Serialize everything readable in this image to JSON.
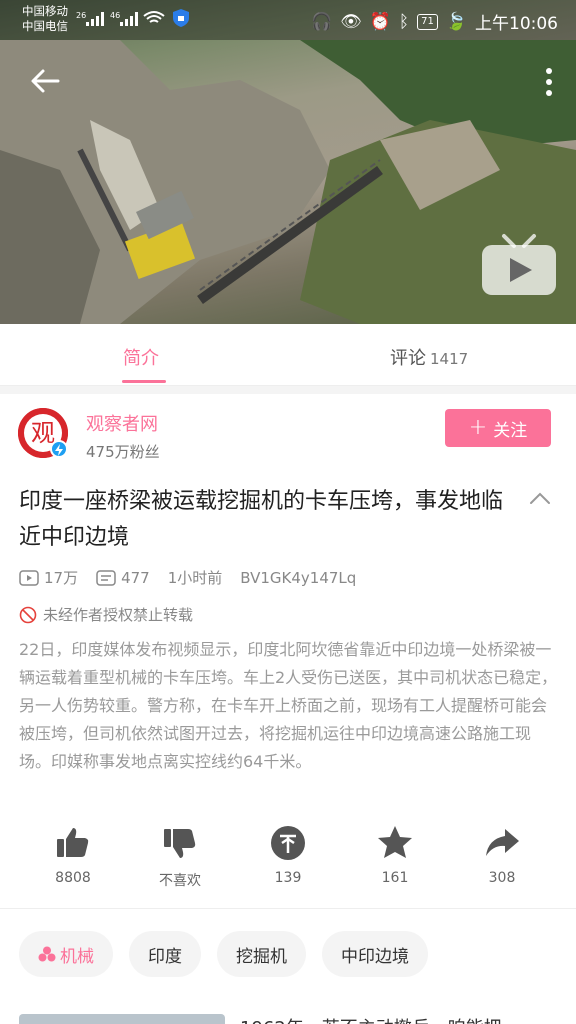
{
  "status_bar": {
    "carrier_1": "中国移动",
    "carrier_2": "中国电信",
    "net_1": "26",
    "net_2": "46",
    "battery": "71",
    "time": "上午10:06"
  },
  "video": {
    "back_icon": "arrow-left-icon",
    "more_icon": "more-vertical-icon",
    "tv_icon": "bilibili-tv-play-icon"
  },
  "tabs": [
    {
      "label": "简介",
      "active": true
    },
    {
      "label": "评论",
      "count": "1417",
      "active": false
    }
  ],
  "author": {
    "name": "观察者网",
    "fans": "475万粉丝",
    "follow_label": "关注",
    "avatar_char": "观"
  },
  "video_info": {
    "title": "印度一座桥梁被运载挖掘机的卡车压垮，事发地临近中印边境",
    "views": "17万",
    "danmaku": "477",
    "time_ago": "1小时前",
    "bvid": "BV1GK4y147Lq",
    "notice": "未经作者授权禁止转载",
    "description": "22日，印度媒体发布视频显示，印度北阿坎德省靠近中印边境一处桥梁被一辆运载着重型机械的卡车压垮。车上2人受伤已送医，其中司机状态已稳定，另一人伤势较重。警方称，在卡车开上桥面之前，现场有工人提醒桥可能会被压垮，但司机依然试图开过去，将挖掘机运往中印边境高速公路施工现场。印媒称事发地点离实控线约64千米。"
  },
  "actions": {
    "like": "8808",
    "dislike": "不喜欢",
    "coin": "139",
    "favorite": "161",
    "share": "308"
  },
  "tags": [
    "机械",
    "印度",
    "挖掘机",
    "中印边境"
  ],
  "next": {
    "title": "1962年，若不主动撤兵，咱能把"
  },
  "colors": {
    "accent": "#fb7299",
    "muted": "#9a9a9a"
  }
}
